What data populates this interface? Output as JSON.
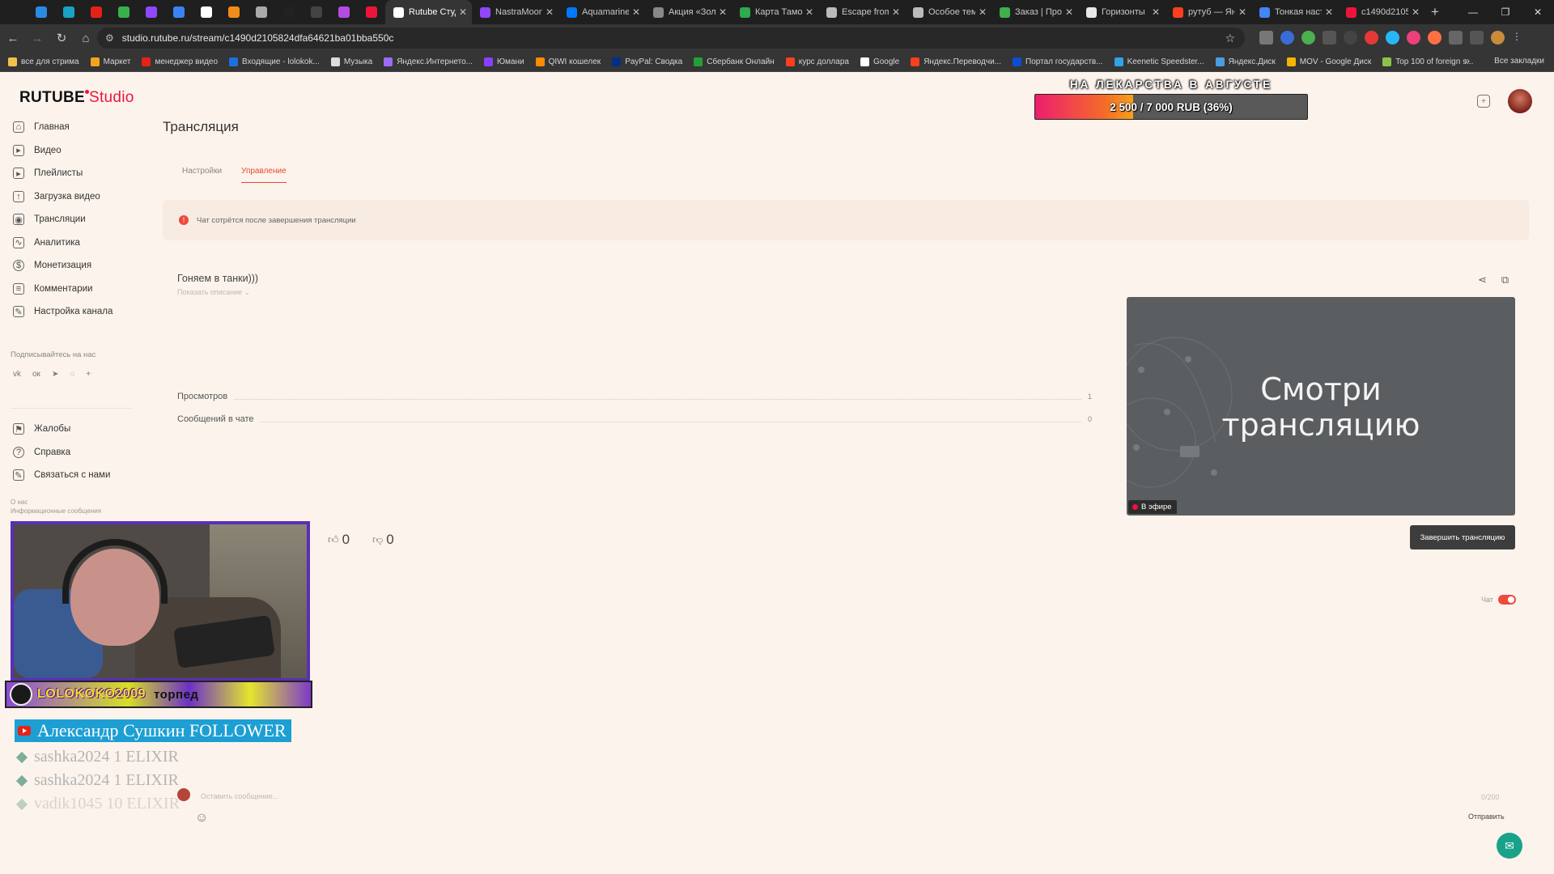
{
  "browser": {
    "tabs": [
      {
        "title": "Rutube Студ",
        "color": "#ffffff",
        "active": true
      },
      {
        "title": "NastraMoon",
        "color": "#9146ff"
      },
      {
        "title": "Aquamarine",
        "color": "#0077ff"
      },
      {
        "title": "Акция «Зол",
        "color": "#888888"
      },
      {
        "title": "Карта Тамож",
        "color": "#2eaa4f"
      },
      {
        "title": "Escape from",
        "color": "#bbbbbb"
      },
      {
        "title": "Особое тема",
        "color": "#bbbbbb"
      },
      {
        "title": "Заказ | Про",
        "color": "#3fb04a"
      },
      {
        "title": "Горизонты",
        "color": "#e8e8e8"
      },
      {
        "title": "рутуб — Янд",
        "color": "#fc3f1d"
      },
      {
        "title": "Тонкая наст",
        "color": "#4285f4"
      },
      {
        "title": "c1490d2105",
        "color": "#ed143b"
      }
    ],
    "pinned_colors": [
      "#2a8be3",
      "#19a2c4",
      "#e62117",
      "#36b14b",
      "#9146ff",
      "#3b82f6",
      "#ffffff",
      "#f28c18",
      "#aaaaaa",
      "#222222",
      "#444444",
      "#b24ce3",
      "#ed143b"
    ],
    "new_tab": "+",
    "url": "studio.rutube.ru/stream/c1490d2105824dfa64621ba01bba550c",
    "bookmarks": [
      {
        "label": "все для стрима",
        "color": "#f2c14e"
      },
      {
        "label": "Маркет",
        "color": "#f2a51a"
      },
      {
        "label": "менеджер видео",
        "color": "#e62117"
      },
      {
        "label": "Входящие - lolokok...",
        "color": "#1d6fe0"
      },
      {
        "label": "Музыка",
        "color": "#dddddd"
      },
      {
        "label": "Яндекс.Интернето...",
        "color": "#9a6cf3"
      },
      {
        "label": "Юмани",
        "color": "#8b3ffd"
      },
      {
        "label": "QIWI кошелек",
        "color": "#ff8c00"
      },
      {
        "label": "PayPal: Сводка",
        "color": "#003087"
      },
      {
        "label": "Сбербанк Онлайн",
        "color": "#21a038"
      },
      {
        "label": "курс доллара",
        "color": "#fc3f1d"
      },
      {
        "label": "Google",
        "color": "#ffffff"
      },
      {
        "label": "Яндекс.Переводчи...",
        "color": "#fc3f1d"
      },
      {
        "label": "Портал государств...",
        "color": "#0d4cd3"
      },
      {
        "label": "Keenetic Speedster...",
        "color": "#2fa3e6"
      },
      {
        "label": "Яндекс.Диск",
        "color": "#4a9de0"
      },
      {
        "label": "MOV - Google Диск",
        "color": "#f4b400"
      },
      {
        "label": "Top 100 of foreign s...",
        "color": "#8bc34a"
      }
    ],
    "all_bookmarks": "Все закладки"
  },
  "app": {
    "logo": "RUTUBE",
    "logo_suffix": "Studio",
    "sidebar": [
      {
        "label": "Главная",
        "icon": "home-icon",
        "glyph": "⌂"
      },
      {
        "label": "Видео",
        "icon": "video-icon",
        "glyph": "▸"
      },
      {
        "label": "Плейлисты",
        "icon": "playlist-icon",
        "glyph": "▸"
      },
      {
        "label": "Загрузка видео",
        "icon": "upload-icon",
        "glyph": "↑"
      },
      {
        "label": "Трансляции",
        "icon": "broadcast-icon",
        "glyph": "◉"
      },
      {
        "label": "Аналитика",
        "icon": "analytics-icon",
        "glyph": "∿"
      },
      {
        "label": "Монетизация",
        "icon": "money-icon",
        "glyph": "$"
      },
      {
        "label": "Комментарии",
        "icon": "comments-icon",
        "glyph": "≡"
      },
      {
        "label": "Настройка канала",
        "icon": "pen-icon",
        "glyph": "✎"
      }
    ],
    "follow_label": "Подписывайтесь на нас",
    "socials": [
      "vk-icon",
      "ok-icon",
      "telegram-icon",
      "viber-icon",
      "more-icon"
    ],
    "social_glyphs": [
      "vk",
      "ок",
      "➤",
      "◌",
      "+"
    ],
    "sidebar2": [
      {
        "label": "Жалобы",
        "icon": "flag-icon",
        "glyph": "⚑"
      },
      {
        "label": "Справка",
        "icon": "help-icon",
        "glyph": "?"
      },
      {
        "label": "Связаться с нами",
        "icon": "contact-icon",
        "glyph": "✎"
      }
    ],
    "about": [
      "О нас",
      "Информационные сообщения"
    ],
    "page_title": "Трансляция",
    "tabs": {
      "settings": "Настройки",
      "manage": "Управление"
    },
    "notice": "Чат сотрётся после завершения трансляции",
    "stream_title": "Гоняем в танки)))",
    "show_description": "Показать описание ⌄",
    "stats": [
      {
        "label": "Просмотров",
        "value": "1"
      },
      {
        "label": "Сообщений в чате",
        "value": "0"
      }
    ],
    "preview_text_1": "Смотри",
    "preview_text_2": "трансляцию",
    "live_label": "В эфире",
    "end_button": "Завершить трансляцию",
    "likes": "0",
    "dislikes": "0",
    "chat_label": "Чат",
    "chat_enabled": true,
    "chat_placeholder": "Оставить сообщение...",
    "chat_counter": "0/200",
    "send_label": "Отправить",
    "accent_color": "#ed143b"
  },
  "overlay": {
    "donation_title": "НА ЛЕКАРСТВА В АВГУСТЕ",
    "donation_text": "2 500 / 7 000 RUB (36%)",
    "donation_fraction": 0.36,
    "cam_name": "LOLOKOKO2009",
    "cam_ticker": "торпед",
    "follower_alert": "Александр Сушкин FOLLOWER",
    "elixir_events": [
      "sashka2024 1 ELIXIR",
      "sashka2024 1 ELIXIR",
      "vadik1045 10 ELIXIR"
    ]
  }
}
